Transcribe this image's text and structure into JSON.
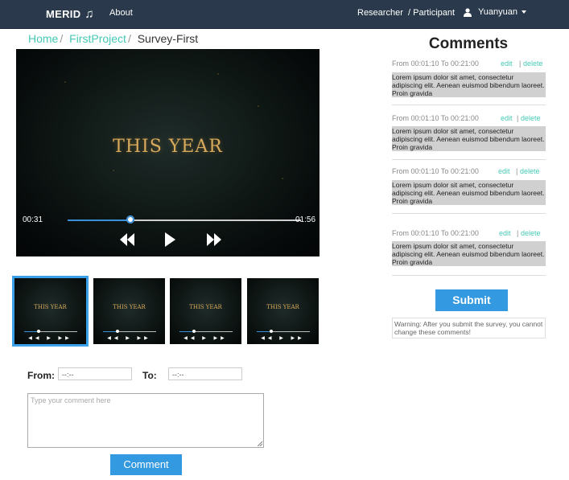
{
  "navbar": {
    "brand": "MERID",
    "brand_icon": "music-note-icon",
    "about": "About",
    "researcher": "Researcher",
    "participant": "/ Participant",
    "user": "Yuanyuan",
    "user_icon": "user-icon",
    "bg_color": "#2a3a4c"
  },
  "breadcrumb": {
    "items": [
      "Home",
      "FirstProject"
    ],
    "separator": "/",
    "current": "Survey-First"
  },
  "video": {
    "title_text": "THIS YEAR",
    "current_time": "00:31",
    "duration": "01:56",
    "progress": 0.27,
    "controls": [
      "rewind-icon",
      "play-icon",
      "fast-forward-icon"
    ]
  },
  "thumbnails": [
    {
      "text": "THIS YEAR",
      "selected": true,
      "progress": 0.27
    },
    {
      "text": "THIS YEAR",
      "selected": false,
      "progress": 0.27
    },
    {
      "text": "THIS YEAR",
      "selected": false,
      "progress": 0.27
    },
    {
      "text": "THIS YEAR",
      "selected": false,
      "progress": 0.27
    }
  ],
  "form": {
    "from_label": "From:",
    "from_value": "--:--",
    "to_label": "To:",
    "to_value": "--:--",
    "comment_placeholder": "Type your comment here",
    "comment_button": "Comment"
  },
  "comments": {
    "heading": "Comments",
    "items": [
      {
        "range": "From 00:01:10 To 00:21:00",
        "edit": "edit",
        "separator": "|",
        "delete": "delete",
        "text": "Lorem ipsum dolor sit amet, consectetur adipiscing elit. Aenean euismod bibendum laoreet. Proin gravida"
      },
      {
        "range": "From 00:01:10 To 00:21:00",
        "edit": "edit",
        "separator": "|",
        "delete": "delete",
        "text": "Lorem ipsum dolor sit amet, consectetur adipiscing elit. Aenean euismod bibendum laoreet. Proin gravida"
      },
      {
        "range": "From 00:01:10 To 00:21:00",
        "edit": "edit",
        "separator": "|",
        "delete": "delete",
        "text": "Lorem ipsum dolor sit amet, consectetur adipiscing elit. Aenean euismod bibendum laoreet. Proin gravida"
      },
      {
        "range": "From 00:01:10 To 00:21:00",
        "edit": "edit",
        "separator": "|",
        "delete": "delete",
        "text": "Lorem ipsum dolor sit amet, consectetur adipiscing elit. Aenean euismod bibendum laoreet. Proin gravida"
      }
    ],
    "submit_button": "Submit",
    "warning": "Warning: After you submit the survey, you cannot change these comments!"
  },
  "colors": {
    "accent": "#46c9b5",
    "button": "#3399e0",
    "progress": "#3a8fd9",
    "thumb_selected": "#3aa0e9"
  }
}
